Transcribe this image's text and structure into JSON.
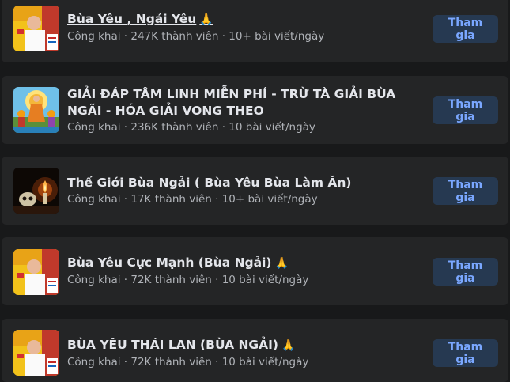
{
  "groups": [
    {
      "name": "Bùa Yêu , Ngải Yêu",
      "emoji": "🙏",
      "privacy": "Công khai",
      "members": "247K thành viên",
      "activity": "10+ bài viết/ngày",
      "button": "Tham gia",
      "thumb": "master-photo"
    },
    {
      "name": "GIẢI ĐÁP TÂM LINH MIỄN PHÍ - TRỪ TÀ GIẢI BÙA NGÃI - HÓA GIẢI VONG THEO",
      "privacy": "Công khai",
      "members": "236K thành viên",
      "activity": "10 bài viết/ngày",
      "button": "Tham gia",
      "thumb": "buddha-painting"
    },
    {
      "name": "Thế Giới Bùa Ngải ( Bùa Yêu Bùa Làm Ăn)",
      "privacy": "Công khai",
      "members": "17K thành viên",
      "activity": "10+ bài viết/ngày",
      "button": "Tham gia",
      "thumb": "candle-skull"
    },
    {
      "name": "Bùa Yêu Cực Mạnh (Bùa Ngải)",
      "emoji": "🙏",
      "privacy": "Công khai",
      "members": "72K thành viên",
      "activity": "10 bài viết/ngày",
      "button": "Tham gia",
      "thumb": "master-photo"
    },
    {
      "name": "BÙA YÊU THÁI LAN (BÙA NGẢI)",
      "emoji": "🙏",
      "privacy": "Công khai",
      "members": "72K thành viên",
      "activity": "10 bài viết/ngày",
      "button": "Tham gia",
      "thumb": "master-photo"
    }
  ],
  "separator": " · ",
  "colors": {
    "page_bg": "#18191a",
    "card_bg": "#242526",
    "title": "#e4e6eb",
    "meta": "#b0b3b8",
    "button_bg": "#263951",
    "button_text": "#7aa7ff"
  }
}
